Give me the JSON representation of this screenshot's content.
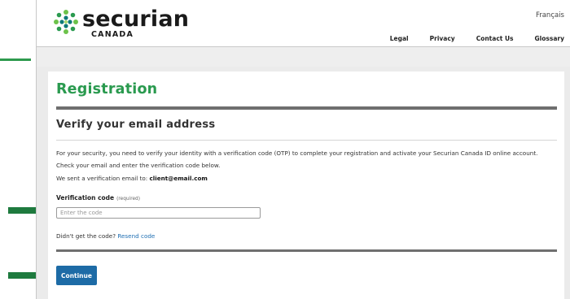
{
  "brand": {
    "name": "securian",
    "subname": "CANADA",
    "primary_color": "#2a9a4f",
    "button_color": "#1d6ba6",
    "link_color": "#1f6fb3",
    "arrow_color": "#1e7a3e"
  },
  "header": {
    "language_link": "Français",
    "nav": [
      "Legal",
      "Privacy",
      "Contact Us",
      "Glossary"
    ]
  },
  "page": {
    "title": "Registration",
    "subtitle": "Verify your email address",
    "paragraph_1": "For your security, you need to verify your identity with a verification code (OTP) to complete your registration and activate your Securian Canada ID online account.",
    "paragraph_2": "Check your email and enter the verification code below.",
    "sent_prefix": "We sent a verification email to:",
    "sent_email": "client@email.com"
  },
  "form": {
    "code_label": "Verification code",
    "code_required": "(required)",
    "code_placeholder": "Enter the code",
    "code_value": "",
    "resend_prefix": "Didn't get the code?",
    "resend_link": "Resend code",
    "continue_label": "Continue"
  }
}
